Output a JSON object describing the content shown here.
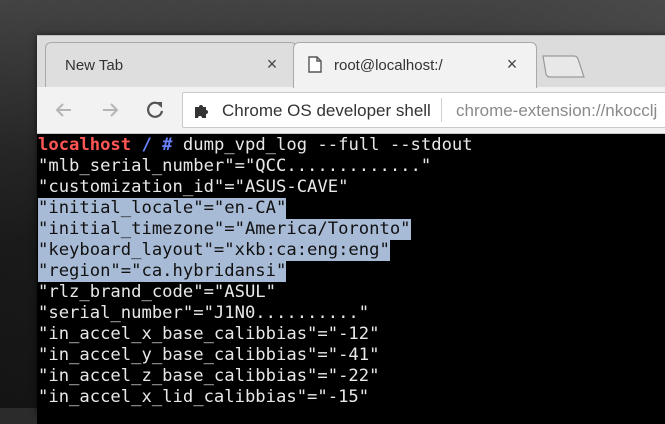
{
  "tabs": [
    {
      "label": "New Tab",
      "close": "×"
    },
    {
      "label": "root@localhost:/",
      "close": "×"
    }
  ],
  "toolbar": {
    "extension_name": "Chrome OS developer shell",
    "url": "chrome-extension://nkocclj"
  },
  "terminal": {
    "prompt_host": "localhost",
    "prompt_path": " / #",
    "command": " dump_vpd_log --full --stdout",
    "lines": [
      "\"mlb_serial_number\"=\"QCC.............\"",
      "\"customization_id\"=\"ASUS-CAVE\"",
      "\"initial_locale\"=\"en-CA\"",
      "\"initial_timezone\"=\"America/Toronto\"",
      "\"keyboard_layout\"=\"xkb:ca:eng:eng\"",
      "\"region\"=\"ca.hybridansi\"",
      "\"rlz_brand_code\"=\"ASUL\"",
      "\"serial_number\"=\"J1N0..........\"",
      "\"in_accel_x_base_calibbias\"=\"-12\"",
      "\"in_accel_y_base_calibbias\"=\"-41\"",
      "\"in_accel_z_base_calibbias\"=\"-22\"",
      "\"in_accel_x_lid_calibbias\"=\"-15\""
    ]
  },
  "colors": {
    "selection": "#a8bbd6",
    "prompt_host": "#ff5555",
    "prompt_path": "#6a82ff"
  }
}
